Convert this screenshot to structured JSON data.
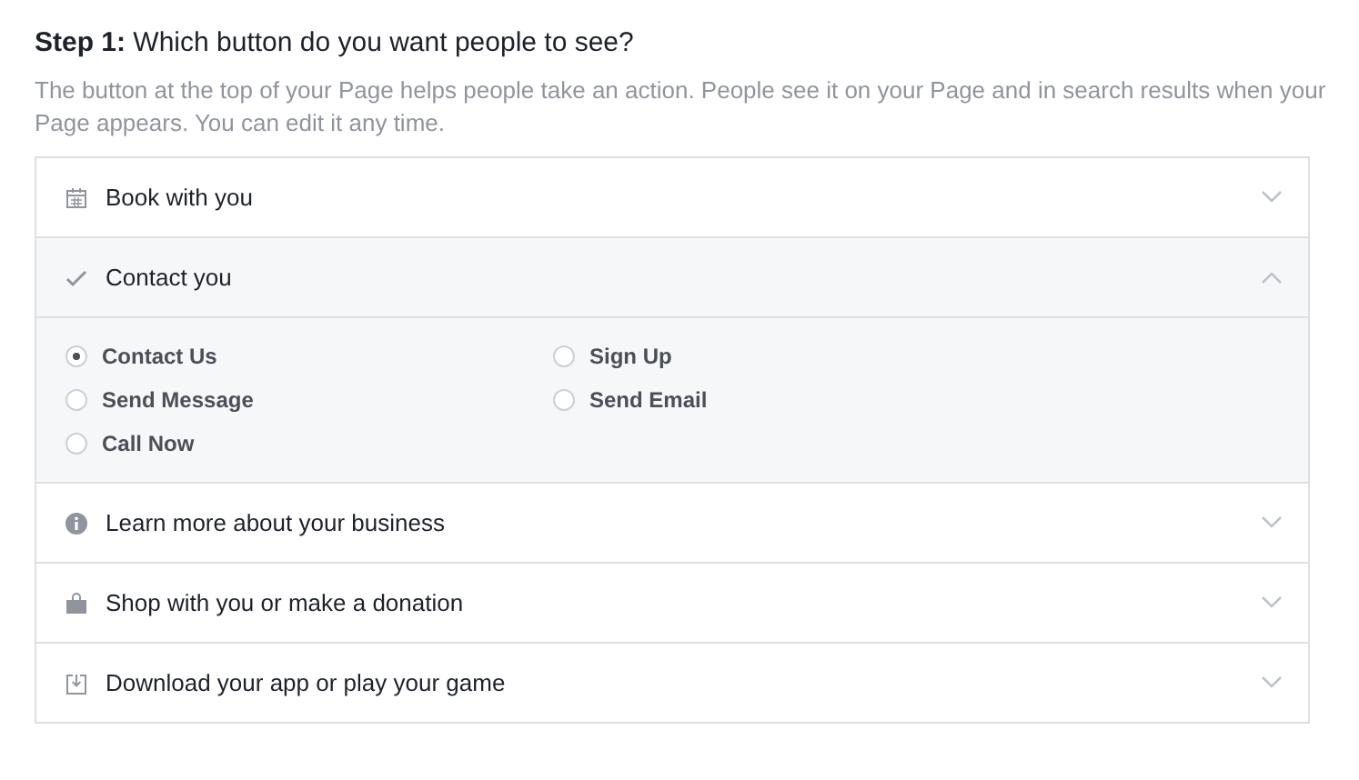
{
  "heading": "**Step 1:** Which button do you want people to see?",
  "description": "The button at the top of your Page helps people take an action. People see it on your Page and in search results when your Page appears. You can edit it any time.",
  "sections": [
    {
      "kind": "calendar",
      "label": "Book with you",
      "expanded": false
    },
    {
      "kind": "check",
      "label": "Contact you",
      "expanded": true,
      "options": [
        {
          "label": "Contact Us",
          "selected": true
        },
        {
          "label": "Sign Up",
          "selected": false
        },
        {
          "label": "Send Message",
          "selected": false
        },
        {
          "label": "Send Email",
          "selected": false
        },
        {
          "label": "Call Now",
          "selected": false
        }
      ]
    },
    {
      "kind": "info",
      "label": "Learn more about your business",
      "expanded": false
    },
    {
      "kind": "bag",
      "label": "Shop with you or make a donation",
      "expanded": false
    },
    {
      "kind": "download",
      "label": "Download your app or play your game",
      "expanded": false
    }
  ]
}
